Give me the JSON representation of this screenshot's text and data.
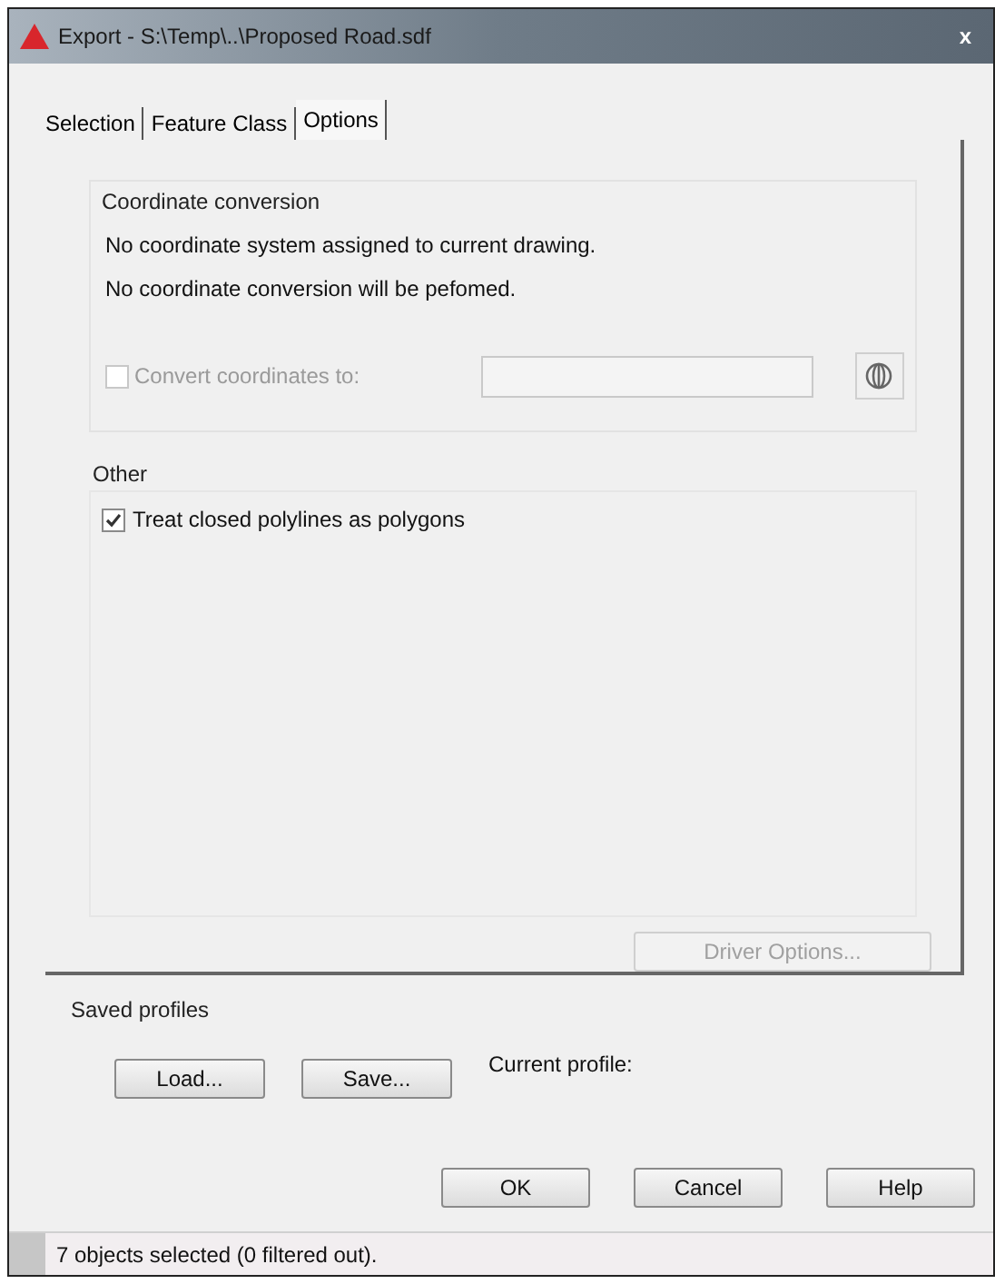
{
  "window": {
    "title": "Export - S:\\Temp\\..\\Proposed Road.sdf",
    "close": "x"
  },
  "tabs": [
    {
      "label": "Selection",
      "selected": false
    },
    {
      "label": "Feature Class",
      "selected": false
    },
    {
      "label": "Options",
      "selected": true
    }
  ],
  "coordinate_conversion": {
    "heading": "Coordinate conversion",
    "lines": [
      "No coordinate system assigned to current drawing.",
      "No coordinate conversion will be pefomed."
    ],
    "convert": {
      "label": "Convert coordinates to:",
      "checked": false,
      "disabled": true
    }
  },
  "other": {
    "heading": "Other",
    "options": [
      {
        "label": "Treat closed polylines as polygons",
        "checked": true
      }
    ]
  },
  "driver_options": {
    "label": "Driver Options...",
    "disabled": true
  },
  "saved_profiles": {
    "heading": "Saved profiles",
    "buttons": [
      "Load...",
      "Save..."
    ],
    "current_profile": "Current profile:"
  },
  "buttons": [
    "OK",
    "Cancel",
    "Help"
  ],
  "status_bar": "7 objects selected (0 filtered out)."
}
